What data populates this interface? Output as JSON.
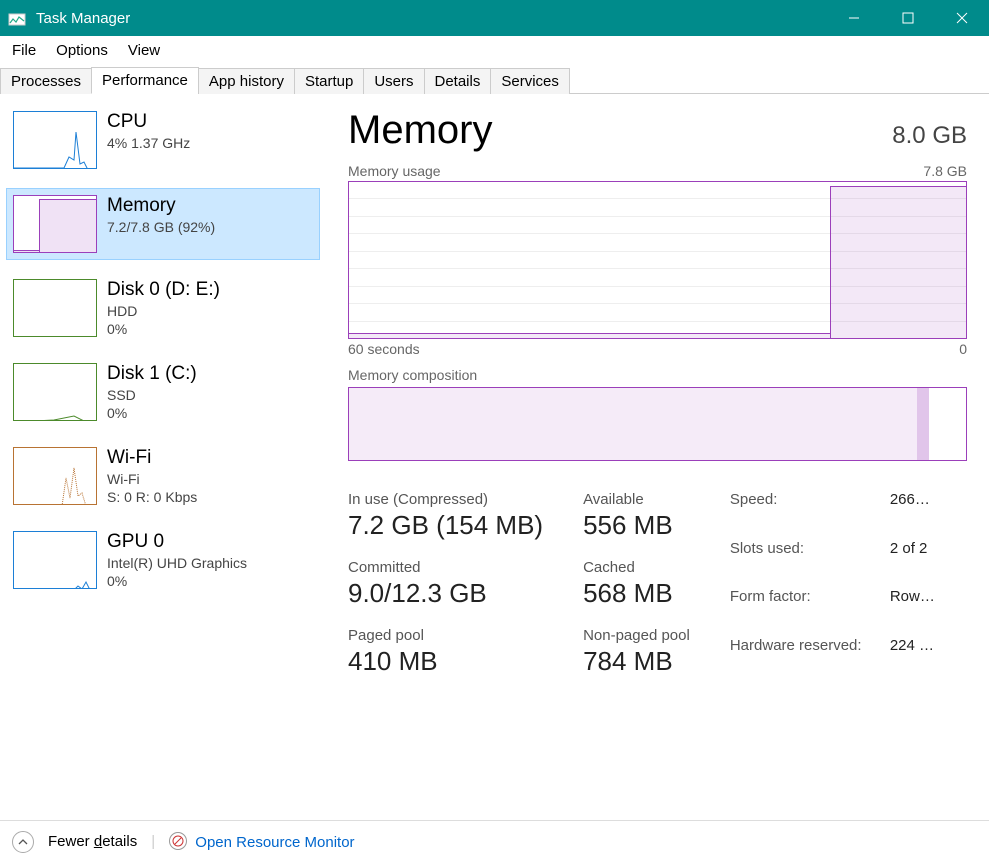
{
  "window": {
    "title": "Task Manager"
  },
  "menu": [
    "File",
    "Options",
    "View"
  ],
  "tabs": [
    "Processes",
    "Performance",
    "App history",
    "Startup",
    "Users",
    "Details",
    "Services"
  ],
  "active_tab": "Performance",
  "sidebar": {
    "cpu": {
      "title": "CPU",
      "sub": "4%  1.37 GHz"
    },
    "mem": {
      "title": "Memory",
      "sub": "7.2/7.8 GB (92%)"
    },
    "disk0": {
      "title": "Disk 0 (D: E:)",
      "sub": "HDD",
      "sub2": "0%"
    },
    "disk1": {
      "title": "Disk 1 (C:)",
      "sub": "SSD",
      "sub2": "0%"
    },
    "wifi": {
      "title": "Wi-Fi",
      "sub": "Wi-Fi",
      "sub2": "S: 0  R:  0 Kbps"
    },
    "gpu": {
      "title": "GPU 0",
      "sub": "Intel(R) UHD Graphics",
      "sub2": "0%"
    }
  },
  "main": {
    "title": "Memory",
    "total": "8.0 GB",
    "usage_label": "Memory usage",
    "usage_max": "7.8 GB",
    "x_left": "60 seconds",
    "x_right": "0",
    "comp_label": "Memory composition",
    "stats": {
      "inuse_label": "In use (Compressed)",
      "inuse_val": "7.2 GB (154 MB)",
      "avail_label": "Available",
      "avail_val": "556 MB",
      "commit_label": "Committed",
      "commit_val": "9.0/12.3 GB",
      "cached_label": "Cached",
      "cached_val": "568 MB",
      "paged_label": "Paged pool",
      "paged_val": "410 MB",
      "nonpaged_label": "Non-paged pool",
      "nonpaged_val": "784 MB"
    },
    "info": {
      "speed_l": "Speed:",
      "speed_v": "266…",
      "slots_l": "Slots used:",
      "slots_v": "2 of 2",
      "form_l": "Form factor:",
      "form_v": "Row…",
      "hwres_l": "Hardware reserved:",
      "hwres_v": "224 …"
    }
  },
  "footer": {
    "fewer_pre": "Fewer ",
    "fewer_ul": "d",
    "fewer_post": "etails",
    "link": "Open Resource Monitor"
  },
  "chart_data": {
    "type": "line",
    "title": "Memory usage",
    "xlabel": "seconds",
    "ylabel": "GB",
    "xlim": [
      60,
      0
    ],
    "ylim": [
      0,
      7.8
    ],
    "x": [
      60,
      50,
      40,
      30,
      20,
      14,
      13,
      10,
      5,
      0
    ],
    "values": [
      0.2,
      0.2,
      0.2,
      0.2,
      0.2,
      0.2,
      7.6,
      7.6,
      7.6,
      7.6
    ],
    "composition": {
      "in_use_pct": 92,
      "modified_pct": 2,
      "standby_free_pct": 6
    }
  }
}
